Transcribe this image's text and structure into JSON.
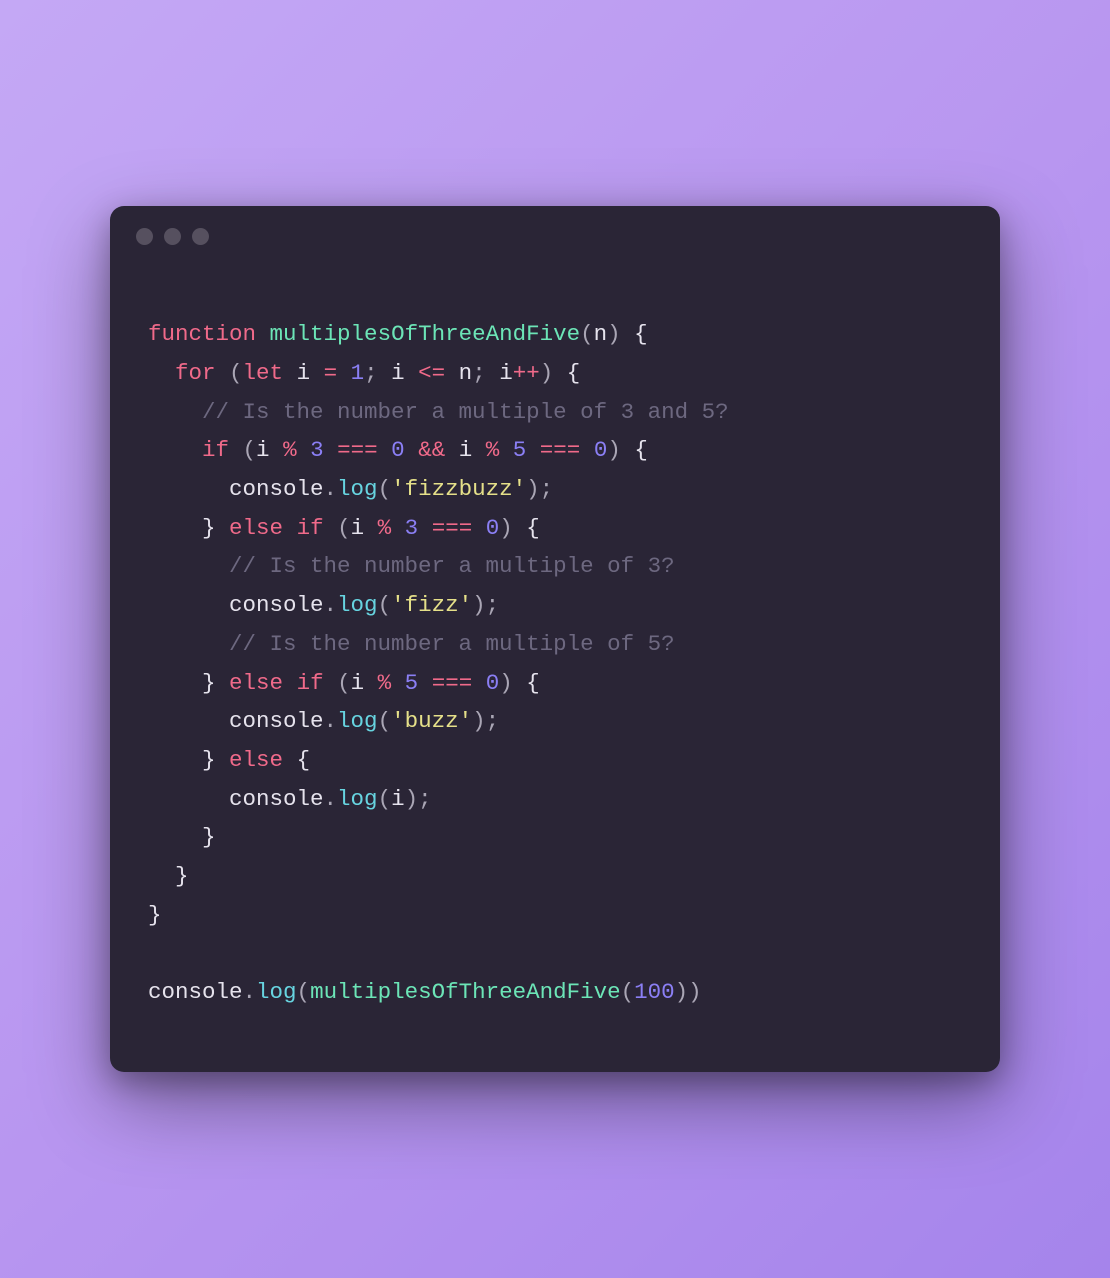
{
  "code": {
    "l1": {
      "kw_function": "function",
      "fn_name": "multiplesOfThreeAndFive",
      "p_open": "(",
      "param": "n",
      "p_close": ")",
      "brace": " {"
    },
    "l2": {
      "indent": "  ",
      "kw_for": "for",
      "p_open": " (",
      "kw_let": "let",
      "var_i": " i ",
      "eq": "=",
      "sp1": " ",
      "num_1": "1",
      "semi1": ";",
      "sp2": " i ",
      "lte": "<=",
      "sp3": " n",
      "semi2": ";",
      "sp4": " i",
      "inc": "++",
      "p_close": ")",
      "brace": " {"
    },
    "l3": {
      "indent": "    ",
      "comment": "// Is the number a multiple of 3 and 5?"
    },
    "l4": {
      "indent": "    ",
      "kw_if": "if",
      "p_open": " (",
      "i1": "i ",
      "mod1": "%",
      "sp1": " ",
      "n3": "3",
      "sp2": " ",
      "eqeq1": "===",
      "sp3": " ",
      "z1": "0",
      "sp4": " ",
      "and": "&&",
      "sp5": " ",
      "i2": "i ",
      "mod2": "%",
      "sp6": " ",
      "n5": "5",
      "sp7": " ",
      "eqeq2": "===",
      "sp8": " ",
      "z2": "0",
      "p_close": ")",
      "brace": " {"
    },
    "l5": {
      "indent": "      ",
      "console": "console",
      "dot": ".",
      "log": "log",
      "p_open": "(",
      "str": "'fizzbuzz'",
      "p_close": ")",
      "semi": ";"
    },
    "l6": {
      "indent": "    ",
      "brace_close": "}",
      "sp": " ",
      "kw_else": "else",
      "sp2": " ",
      "kw_if": "if",
      "p_open": " (",
      "i": "i ",
      "mod": "%",
      "sp3": " ",
      "n3": "3",
      "sp4": " ",
      "eqeq": "===",
      "sp5": " ",
      "z": "0",
      "p_close": ")",
      "brace": " {"
    },
    "l7": {
      "indent": "      ",
      "comment": "// Is the number a multiple of 3?"
    },
    "l8": {
      "indent": "      ",
      "console": "console",
      "dot": ".",
      "log": "log",
      "p_open": "(",
      "str": "'fizz'",
      "p_close": ")",
      "semi": ";"
    },
    "l9": {
      "indent": "      ",
      "comment": "// Is the number a multiple of 5?"
    },
    "l10": {
      "indent": "    ",
      "brace_close": "}",
      "sp": " ",
      "kw_else": "else",
      "sp2": " ",
      "kw_if": "if",
      "p_open": " (",
      "i": "i ",
      "mod": "%",
      "sp3": " ",
      "n5": "5",
      "sp4": " ",
      "eqeq": "===",
      "sp5": " ",
      "z": "0",
      "p_close": ")",
      "brace": " {"
    },
    "l11": {
      "indent": "      ",
      "console": "console",
      "dot": ".",
      "log": "log",
      "p_open": "(",
      "str": "'buzz'",
      "p_close": ")",
      "semi": ";"
    },
    "l12": {
      "indent": "    ",
      "brace_close": "}",
      "sp": " ",
      "kw_else": "else",
      "brace": " {"
    },
    "l13": {
      "indent": "      ",
      "console": "console",
      "dot": ".",
      "log": "log",
      "p_open": "(",
      "var_i": "i",
      "p_close": ")",
      "semi": ";"
    },
    "l14": {
      "indent": "    ",
      "brace": "}"
    },
    "l15": {
      "indent": "  ",
      "brace": "}"
    },
    "l16": {
      "brace": "}"
    },
    "l17": {
      "blank": ""
    },
    "l18": {
      "console": "console",
      "dot": ".",
      "log": "log",
      "p_open": "(",
      "fn_call": "multiplesOfThreeAndFive",
      "p_open2": "(",
      "num": "100",
      "p_close2": ")",
      "p_close": ")"
    }
  }
}
